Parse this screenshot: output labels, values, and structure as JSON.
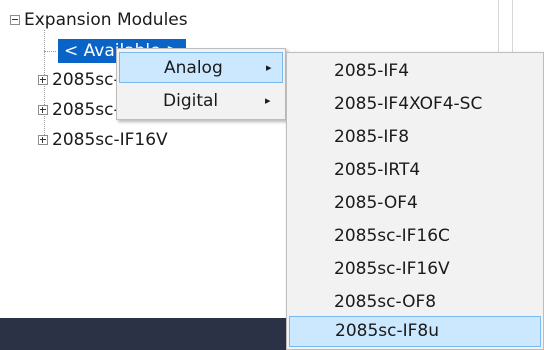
{
  "tree": {
    "root_label": "Expansion Modules",
    "selected_label": "< Available >",
    "children": [
      "2085sc-",
      "2085sc-",
      "2085sc-IF16V"
    ]
  },
  "context_menu": {
    "items": [
      {
        "label": "Analog",
        "arrow": "▸",
        "highlighted": true
      },
      {
        "label": "Digital",
        "arrow": "▸",
        "highlighted": false
      }
    ]
  },
  "submenu": {
    "items": [
      {
        "label": "2085-IF4"
      },
      {
        "label": "2085-IF4XOF4-SC"
      },
      {
        "label": "2085-IF8"
      },
      {
        "label": "2085-IRT4"
      },
      {
        "label": "2085-OF4"
      },
      {
        "label": "2085sc-IF16C"
      },
      {
        "label": "2085sc-IF16V"
      },
      {
        "label": "2085sc-OF8"
      },
      {
        "label": "2085sc-IF8u"
      }
    ],
    "highlighted_index": 8
  },
  "icons": {
    "collapse": "minus-box-icon",
    "expand": "plus-box-icon",
    "submenu_arrow": "chevron-right-icon"
  },
  "colors": {
    "selection_bg": "#0a64c8",
    "menu_bg": "#f2f2f2",
    "highlight_bg": "#cce8ff",
    "highlight_border": "#7ab8f0",
    "bottom_bar": "#2b3245"
  }
}
